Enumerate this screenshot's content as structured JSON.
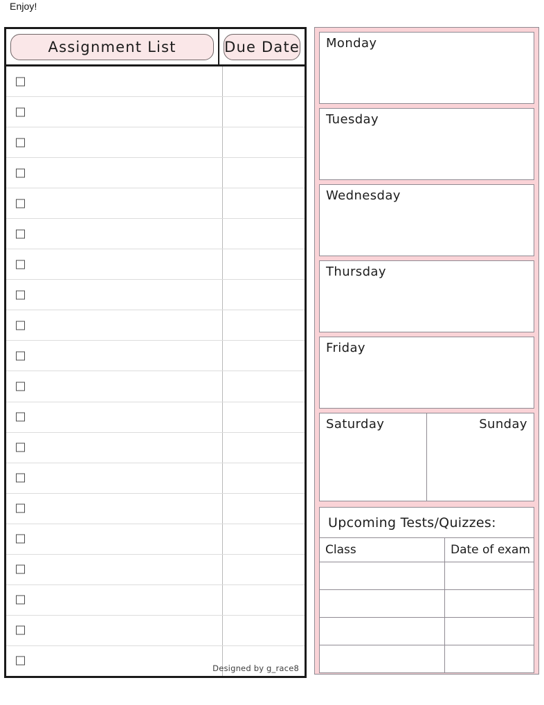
{
  "page": {
    "top_note": "Enjoy!",
    "credit": "Designed by g_race8",
    "colors": {
      "panel_pink": "#fad3d7",
      "header_pill_pink": "#fae7e8",
      "box_border": "#8f8a92",
      "table_border": "#1a1a1a",
      "row_divider": "#dcdcdc"
    }
  },
  "assignment_table": {
    "headers": {
      "list": "Assignment List",
      "due": "Due Date"
    },
    "row_count": 20,
    "rows": [
      {
        "checked": false,
        "task": "",
        "due": ""
      },
      {
        "checked": false,
        "task": "",
        "due": ""
      },
      {
        "checked": false,
        "task": "",
        "due": ""
      },
      {
        "checked": false,
        "task": "",
        "due": ""
      },
      {
        "checked": false,
        "task": "",
        "due": ""
      },
      {
        "checked": false,
        "task": "",
        "due": ""
      },
      {
        "checked": false,
        "task": "",
        "due": ""
      },
      {
        "checked": false,
        "task": "",
        "due": ""
      },
      {
        "checked": false,
        "task": "",
        "due": ""
      },
      {
        "checked": false,
        "task": "",
        "due": ""
      },
      {
        "checked": false,
        "task": "",
        "due": ""
      },
      {
        "checked": false,
        "task": "",
        "due": ""
      },
      {
        "checked": false,
        "task": "",
        "due": ""
      },
      {
        "checked": false,
        "task": "",
        "due": ""
      },
      {
        "checked": false,
        "task": "",
        "due": ""
      },
      {
        "checked": false,
        "task": "",
        "due": ""
      },
      {
        "checked": false,
        "task": "",
        "due": ""
      },
      {
        "checked": false,
        "task": "",
        "due": ""
      },
      {
        "checked": false,
        "task": "",
        "due": ""
      },
      {
        "checked": false,
        "task": "",
        "due": ""
      }
    ]
  },
  "week_planner": {
    "weekdays": [
      {
        "label": "Monday",
        "notes": ""
      },
      {
        "label": "Tuesday",
        "notes": ""
      },
      {
        "label": "Wednesday",
        "notes": ""
      },
      {
        "label": "Thursday",
        "notes": ""
      },
      {
        "label": "Friday",
        "notes": ""
      }
    ],
    "weekend": {
      "saturday": {
        "label": "Saturday",
        "notes": ""
      },
      "sunday": {
        "label": "Sunday",
        "notes": ""
      }
    },
    "tests": {
      "title": "Upcoming Tests/Quizzes:",
      "columns": [
        "Class",
        "Date of exam"
      ],
      "rows": [
        {
          "class": "",
          "date": ""
        },
        {
          "class": "",
          "date": ""
        },
        {
          "class": "",
          "date": ""
        },
        {
          "class": "",
          "date": ""
        }
      ]
    }
  }
}
